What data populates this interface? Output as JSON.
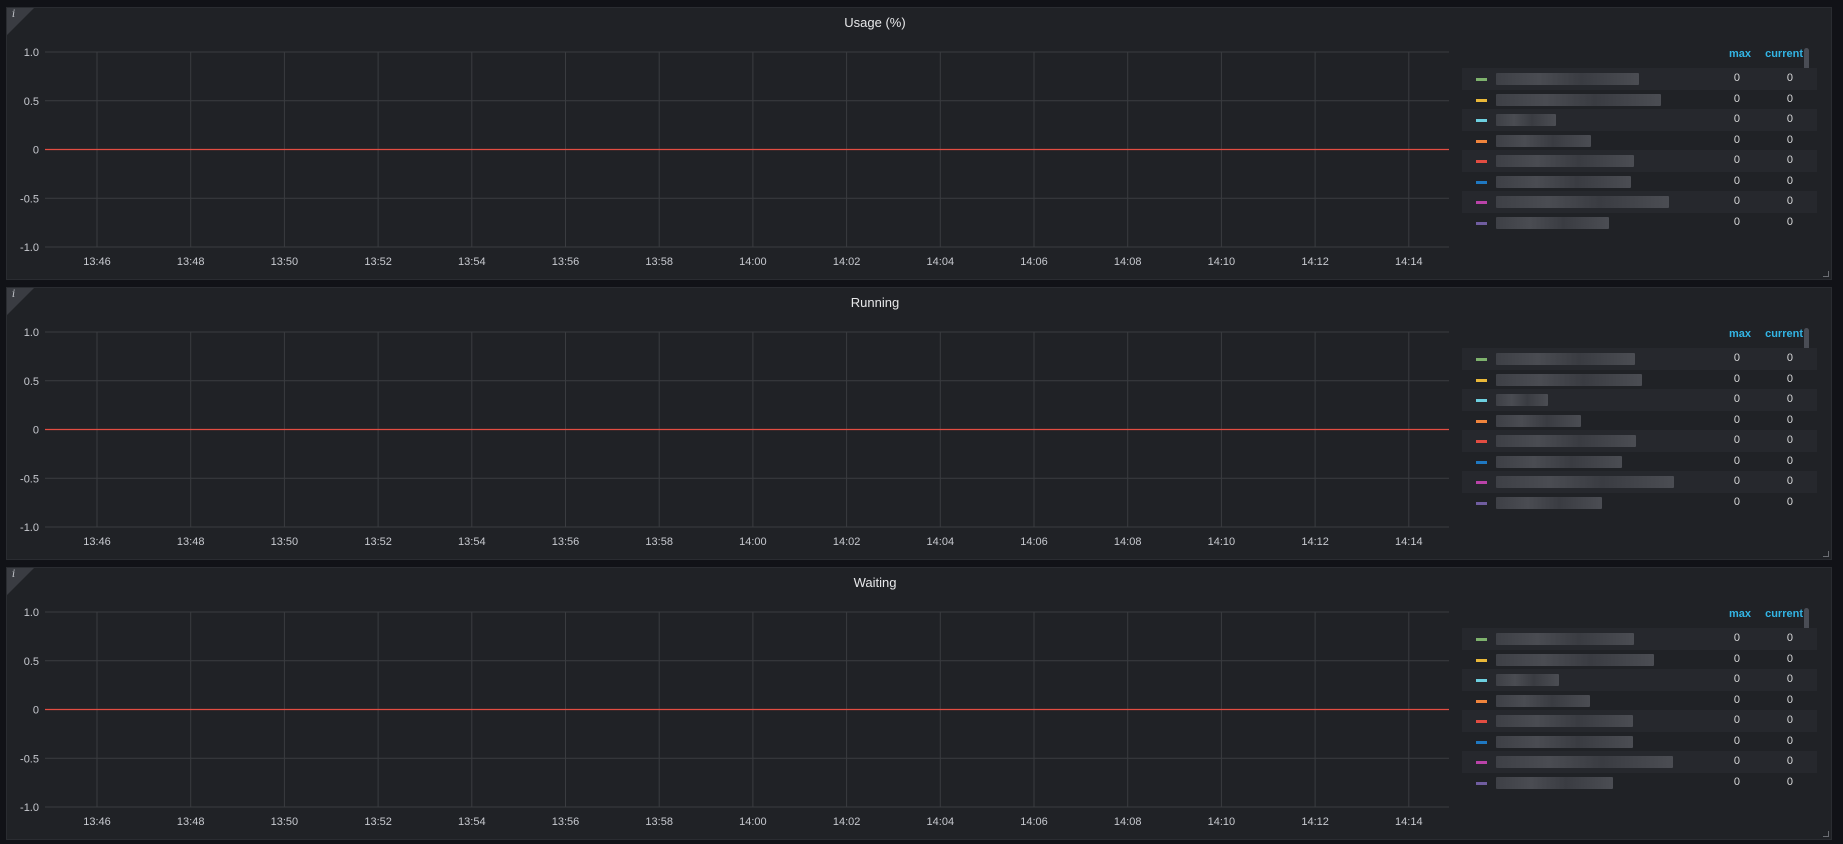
{
  "panels": [
    {
      "title": "Usage (%)",
      "chart_data": {
        "type": "line",
        "title": "Usage (%)",
        "ylim": [
          -1.0,
          1.0
        ],
        "yticks": [
          "1.0",
          "0.5",
          "0",
          "-0.5",
          "-1.0"
        ],
        "x": [
          "13:46",
          "13:48",
          "13:50",
          "13:52",
          "13:54",
          "13:56",
          "13:58",
          "14:00",
          "14:02",
          "14:04",
          "14:06",
          "14:08",
          "14:10",
          "14:12",
          "14:14"
        ],
        "series": [
          {
            "values": [
              0,
              0,
              0,
              0,
              0,
              0,
              0,
              0,
              0,
              0,
              0,
              0,
              0,
              0,
              0
            ],
            "color": "#e24d42"
          }
        ],
        "grid": true,
        "legend_placement": "right"
      },
      "legend": {
        "headers": [
          "max",
          "current"
        ],
        "rows": [
          {
            "color": "#7eb26d",
            "max": "0",
            "current": "0"
          },
          {
            "color": "#eab839",
            "max": "0",
            "current": "0"
          },
          {
            "color": "#6ed0e0",
            "max": "0",
            "current": "0"
          },
          {
            "color": "#ef843c",
            "max": "0",
            "current": "0"
          },
          {
            "color": "#e24d42",
            "max": "0",
            "current": "0"
          },
          {
            "color": "#1f78c1",
            "max": "0",
            "current": "0"
          },
          {
            "color": "#ba43a9",
            "max": "0",
            "current": "0"
          },
          {
            "color": "#705da0",
            "max": "0",
            "current": "0"
          }
        ]
      }
    },
    {
      "title": "Running",
      "chart_data": {
        "type": "line",
        "title": "Running",
        "ylim": [
          -1.0,
          1.0
        ],
        "yticks": [
          "1.0",
          "0.5",
          "0",
          "-0.5",
          "-1.0"
        ],
        "x": [
          "13:46",
          "13:48",
          "13:50",
          "13:52",
          "13:54",
          "13:56",
          "13:58",
          "14:00",
          "14:02",
          "14:04",
          "14:06",
          "14:08",
          "14:10",
          "14:12",
          "14:14"
        ],
        "series": [
          {
            "values": [
              0,
              0,
              0,
              0,
              0,
              0,
              0,
              0,
              0,
              0,
              0,
              0,
              0,
              0,
              0
            ],
            "color": "#e24d42"
          }
        ],
        "grid": true,
        "legend_placement": "right"
      },
      "legend": {
        "headers": [
          "max",
          "current"
        ],
        "rows": [
          {
            "color": "#7eb26d",
            "max": "0",
            "current": "0"
          },
          {
            "color": "#eab839",
            "max": "0",
            "current": "0"
          },
          {
            "color": "#6ed0e0",
            "max": "0",
            "current": "0"
          },
          {
            "color": "#ef843c",
            "max": "0",
            "current": "0"
          },
          {
            "color": "#e24d42",
            "max": "0",
            "current": "0"
          },
          {
            "color": "#1f78c1",
            "max": "0",
            "current": "0"
          },
          {
            "color": "#ba43a9",
            "max": "0",
            "current": "0"
          },
          {
            "color": "#705da0",
            "max": "0",
            "current": "0"
          }
        ]
      }
    },
    {
      "title": "Waiting",
      "chart_data": {
        "type": "line",
        "title": "Waiting",
        "ylim": [
          -1.0,
          1.0
        ],
        "yticks": [
          "1.0",
          "0.5",
          "0",
          "-0.5",
          "-1.0"
        ],
        "x": [
          "13:46",
          "13:48",
          "13:50",
          "13:52",
          "13:54",
          "13:56",
          "13:58",
          "14:00",
          "14:02",
          "14:04",
          "14:06",
          "14:08",
          "14:10",
          "14:12",
          "14:14"
        ],
        "series": [
          {
            "values": [
              0,
              0,
              0,
              0,
              0,
              0,
              0,
              0,
              0,
              0,
              0,
              0,
              0,
              0,
              0
            ],
            "color": "#e24d42"
          }
        ],
        "grid": true,
        "legend_placement": "right"
      },
      "legend": {
        "headers": [
          "max",
          "current"
        ],
        "rows": [
          {
            "color": "#7eb26d",
            "max": "0",
            "current": "0"
          },
          {
            "color": "#eab839",
            "max": "0",
            "current": "0"
          },
          {
            "color": "#6ed0e0",
            "max": "0",
            "current": "0"
          },
          {
            "color": "#ef843c",
            "max": "0",
            "current": "0"
          },
          {
            "color": "#e24d42",
            "max": "0",
            "current": "0"
          },
          {
            "color": "#1f78c1",
            "max": "0",
            "current": "0"
          },
          {
            "color": "#ba43a9",
            "max": "0",
            "current": "0"
          },
          {
            "color": "#705da0",
            "max": "0",
            "current": "0"
          }
        ]
      }
    }
  ]
}
